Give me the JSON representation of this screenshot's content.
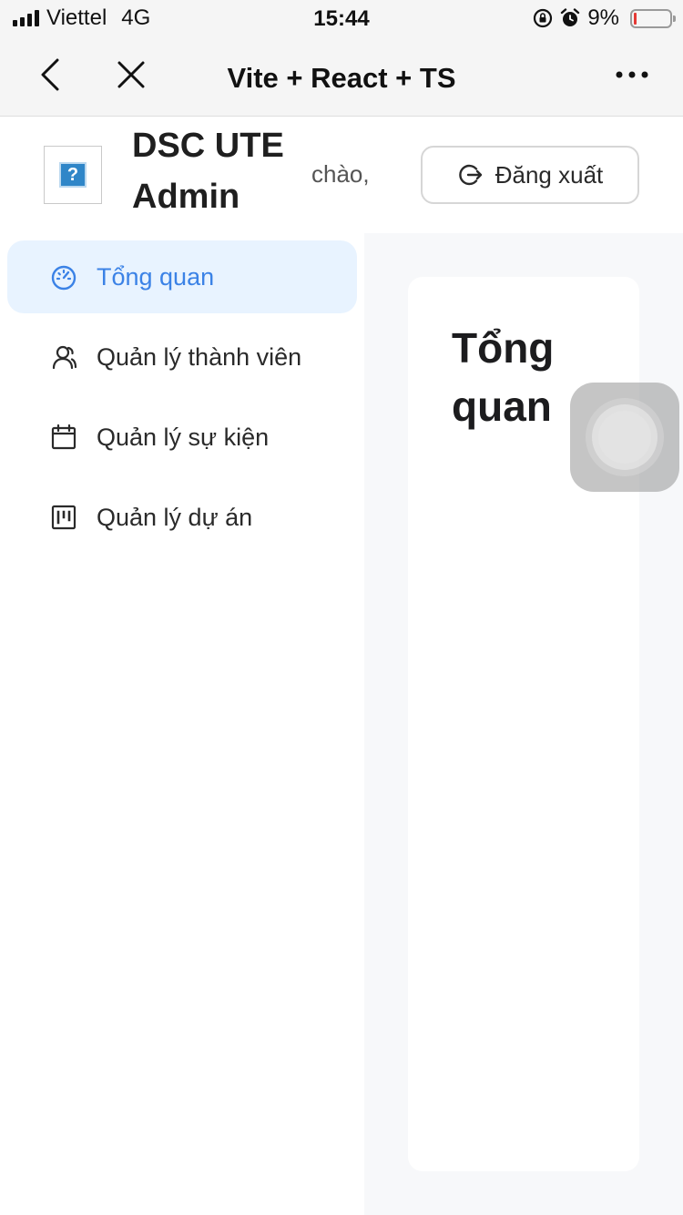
{
  "status_bar": {
    "carrier": "Viettel",
    "network": "4G",
    "time": "15:44",
    "battery_percent": "9%",
    "battery_level": 0.09,
    "battery_color": "#e53935",
    "icons": [
      "signal-icon",
      "rotation-lock-icon",
      "alarm-icon",
      "battery-icon"
    ]
  },
  "browser": {
    "title": "Vite + React + TS",
    "icons": [
      "back-icon",
      "close-icon",
      "more-icon"
    ]
  },
  "header": {
    "brand": "DSC UTE Admin",
    "greeting": "chào,",
    "logout_label": "Đăng xuất",
    "logo_glyph": "?"
  },
  "sidebar": {
    "active_color": "#3b82e6",
    "active_bg": "#e8f3ff",
    "items": [
      {
        "label": "Tổng quan",
        "icon": "dashboard-icon",
        "active": true
      },
      {
        "label": "Quản lý thành viên",
        "icon": "users-icon",
        "active": false
      },
      {
        "label": "Quản lý sự kiện",
        "icon": "calendar-icon",
        "active": false
      },
      {
        "label": "Quản lý dự án",
        "icon": "project-board-icon",
        "active": false
      }
    ]
  },
  "main": {
    "title": "Tổng quan"
  }
}
